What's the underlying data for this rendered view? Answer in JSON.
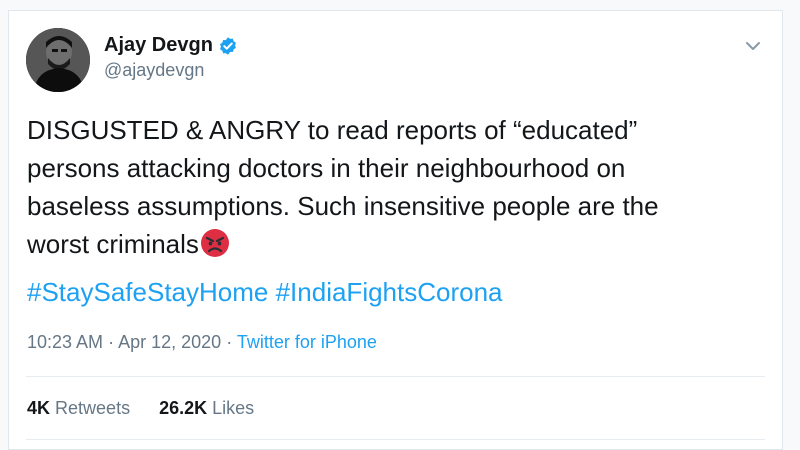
{
  "tweet": {
    "author": {
      "display_name": "Ajay Devgn",
      "handle": "@ajaydevgn",
      "verified": true,
      "verified_icon": "verified-badge-icon",
      "avatar": "profile-photo"
    },
    "menu_icon": "chevron-down-icon",
    "text_lines": [
      "DISGUSTED & ANGRY to read reports of “educated”",
      "persons attacking doctors in their neighbourhood on",
      "baseless assumptions. Such insensitive people are the",
      "worst criminals"
    ],
    "emoji": "angry-face-emoji",
    "hashtags": [
      "#StaySafeStayHome",
      "#IndiaFightsCorona"
    ],
    "time": "10:23 AM",
    "separator": "·",
    "date": "Apr 12, 2020",
    "source": "Twitter for iPhone",
    "retweets": {
      "count": "4K",
      "label": "Retweets"
    },
    "likes": {
      "count": "26.2K",
      "label": "Likes"
    }
  },
  "colors": {
    "link": "#1da1f2",
    "text": "#14171a",
    "secondary": "#657786",
    "border": "#e6ecf0"
  }
}
